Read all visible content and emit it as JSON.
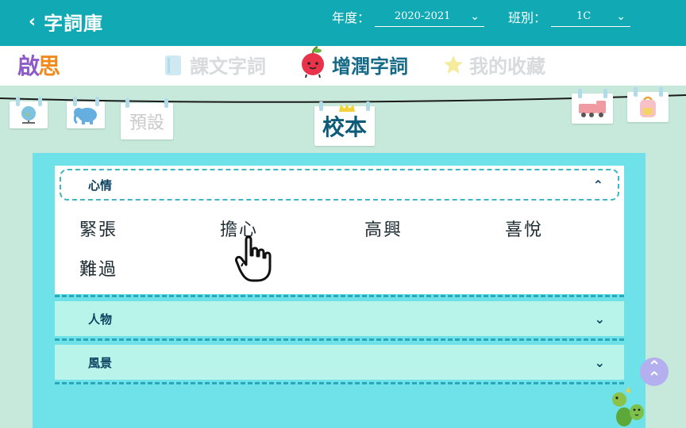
{
  "header": {
    "back_label": "字詞庫",
    "year_label": "年度：",
    "year_value": "2020-2021",
    "class_label": "班別：",
    "class_value": "1C"
  },
  "logo": {
    "part1": "啟",
    "part2": "思"
  },
  "nav": {
    "tabs": [
      {
        "label": "課文字詞",
        "active": false
      },
      {
        "label": "增潤字詞",
        "active": true
      },
      {
        "label": "我的收藏",
        "active": false
      }
    ]
  },
  "hangers": {
    "preset": "預設",
    "school": "校本"
  },
  "groups": [
    {
      "label": "心情",
      "expanded": true,
      "words": [
        "緊張",
        "擔心",
        "高興",
        "喜悅",
        "難過"
      ]
    },
    {
      "label": "人物",
      "expanded": false
    },
    {
      "label": "風景",
      "expanded": false
    }
  ],
  "colors": {
    "header": "#11aab4",
    "panel": "#6ee2e8",
    "collapsed_group": "#b8f4ea",
    "active_tab": "#146a86"
  },
  "icons": {
    "back": "chevron-left-icon",
    "expand": "chevron-down-icon",
    "collapse": "chevron-up-icon",
    "scroll_top": "double-chevron-up-icon"
  }
}
